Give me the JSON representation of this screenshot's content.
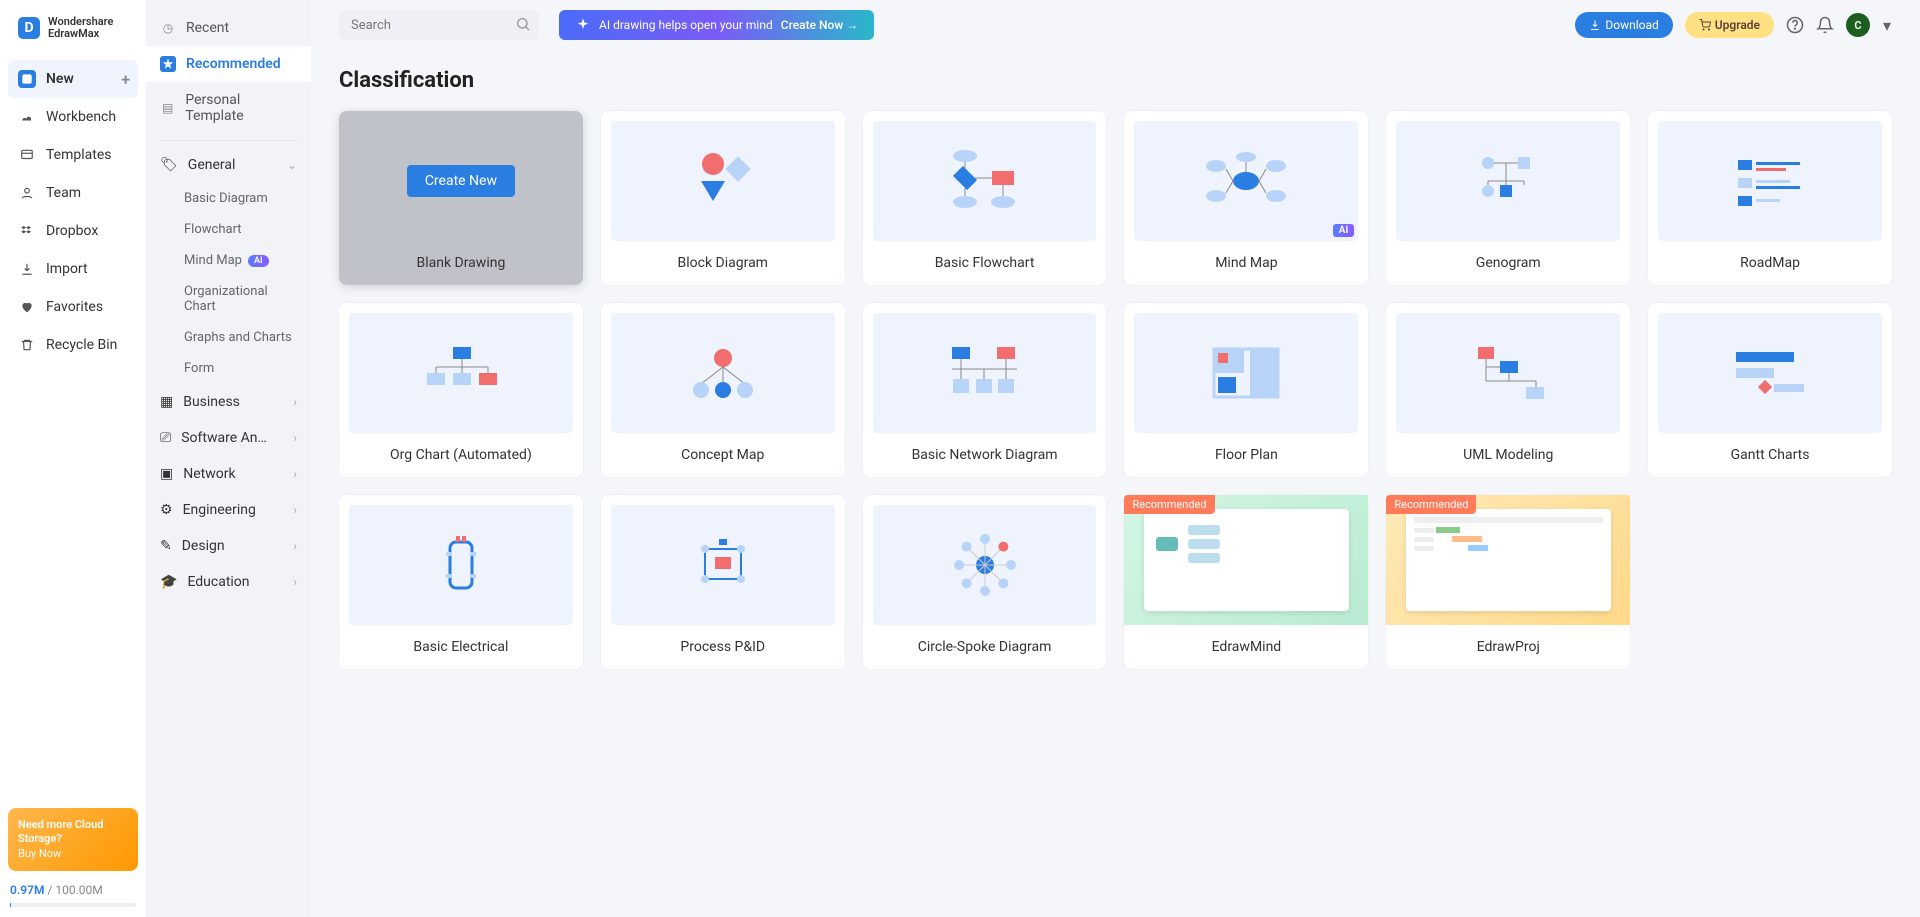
{
  "brand": {
    "name": "Wondershare\nEdrawMax",
    "initial": "D"
  },
  "nav1": [
    {
      "label": "New",
      "active": true,
      "hasPlus": true
    },
    {
      "label": "Workbench"
    },
    {
      "label": "Templates"
    },
    {
      "label": "Team"
    },
    {
      "label": "Dropbox"
    },
    {
      "label": "Import"
    },
    {
      "label": "Favorites"
    },
    {
      "label": "Recycle Bin"
    }
  ],
  "promo": {
    "line1": "Need more Cloud Storage?",
    "cta": "Buy Now"
  },
  "storage": {
    "used": "0.97M",
    "total": "100.00M"
  },
  "sidebar2": {
    "top": [
      {
        "label": "Recent",
        "icon": "clock"
      },
      {
        "label": "Recommended",
        "icon": "star",
        "active": true
      },
      {
        "label": "Personal Template",
        "icon": "template"
      }
    ],
    "general": {
      "label": "General",
      "items": [
        {
          "label": "Basic Diagram"
        },
        {
          "label": "Flowchart"
        },
        {
          "label": "Mind Map",
          "ai": true
        },
        {
          "label": "Organizational Chart"
        },
        {
          "label": "Graphs and Charts"
        },
        {
          "label": "Form"
        }
      ]
    },
    "groups": [
      {
        "label": "Business"
      },
      {
        "label": "Software An…"
      },
      {
        "label": "Network"
      },
      {
        "label": "Engineering"
      },
      {
        "label": "Design"
      },
      {
        "label": "Education"
      }
    ]
  },
  "search": {
    "placeholder": "Search"
  },
  "aiBanner": {
    "text": "AI drawing helps open your mind",
    "cta": "Create Now  →"
  },
  "topButtons": {
    "download": "Download",
    "upgrade": "Upgrade"
  },
  "avatar": "C",
  "section": "Classification",
  "badge_ai": "AI",
  "badge_rec": "Recommended",
  "cards": [
    {
      "label": "Blank Drawing",
      "hover": true,
      "createLabel": "Create New",
      "svg": "blank"
    },
    {
      "label": "Block Diagram",
      "svg": "block"
    },
    {
      "label": "Basic Flowchart",
      "svg": "flowchart"
    },
    {
      "label": "Mind Map",
      "svg": "mindmap",
      "ai": true
    },
    {
      "label": "Genogram",
      "svg": "genogram"
    },
    {
      "label": "RoadMap",
      "svg": "roadmap"
    },
    {
      "label": "Org Chart (Automated)",
      "svg": "orgchart"
    },
    {
      "label": "Concept Map",
      "svg": "concept"
    },
    {
      "label": "Basic Network Diagram",
      "svg": "network"
    },
    {
      "label": "Floor Plan",
      "svg": "floorplan"
    },
    {
      "label": "UML Modeling",
      "svg": "uml"
    },
    {
      "label": "Gantt Charts",
      "svg": "gantt"
    },
    {
      "label": "Basic Electrical",
      "svg": "electrical"
    },
    {
      "label": "Process P&ID",
      "svg": "pid"
    },
    {
      "label": "Circle-Spoke Diagram",
      "svg": "spoke"
    },
    {
      "label": "EdrawMind",
      "svg": "edrawmind",
      "recommended": true,
      "imgStyle": true
    },
    {
      "label": "EdrawProj",
      "svg": "edrawproj",
      "recommended": true,
      "imgStyle": true
    }
  ]
}
